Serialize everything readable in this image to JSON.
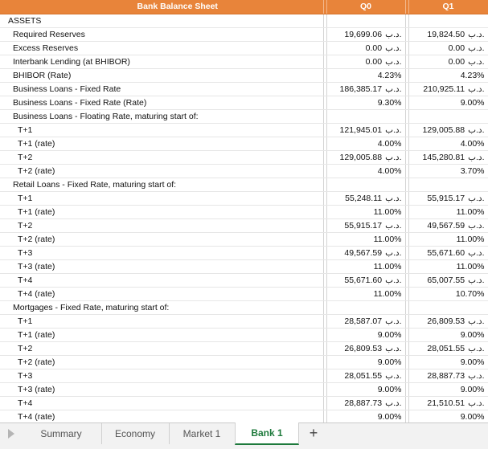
{
  "sheet": {
    "headers": {
      "title": "Bank Balance Sheet",
      "q0": "Q0",
      "q1": "Q1"
    },
    "currency": "د.ب.",
    "rows": [
      {
        "label": "ASSETS",
        "indent": "top",
        "q0": "",
        "q1": "",
        "cur": false
      },
      {
        "label": "Required Reserves",
        "indent": "main",
        "q0": "19,699.06",
        "q1": "19,824.50",
        "cur": true
      },
      {
        "label": "Excess Reserves",
        "indent": "main",
        "q0": "0.00",
        "q1": "0.00",
        "cur": true
      },
      {
        "label": "Interbank Lending (at BHIBOR)",
        "indent": "main",
        "q0": "0.00",
        "q1": "0.00",
        "cur": true
      },
      {
        "label": "BHIBOR (Rate)",
        "indent": "main",
        "q0": "4.23%",
        "q1": "4.23%",
        "cur": false
      },
      {
        "label": "Business Loans - Fixed Rate",
        "indent": "main",
        "q0": "186,385.17",
        "q1": "210,925.11",
        "cur": true
      },
      {
        "label": "Business Loans - Fixed Rate (Rate)",
        "indent": "main",
        "q0": "9.30%",
        "q1": "9.00%",
        "cur": false
      },
      {
        "label": "Business Loans - Floating Rate, maturing start of:",
        "indent": "main",
        "q0": "",
        "q1": "",
        "cur": false
      },
      {
        "label": "T+1",
        "indent": "sub",
        "q0": "121,945.01",
        "q1": "129,005.88",
        "cur": true
      },
      {
        "label": "T+1 (rate)",
        "indent": "sub",
        "q0": "4.00%",
        "q1": "4.00%",
        "cur": false
      },
      {
        "label": "T+2",
        "indent": "sub",
        "q0": "129,005.88",
        "q1": "145,280.81",
        "cur": true
      },
      {
        "label": "T+2 (rate)",
        "indent": "sub",
        "q0": "4.00%",
        "q1": "3.70%",
        "cur": false
      },
      {
        "label": "Retail Loans - Fixed Rate, maturing start of:",
        "indent": "main",
        "q0": "",
        "q1": "",
        "cur": false
      },
      {
        "label": "T+1",
        "indent": "sub",
        "q0": "55,248.11",
        "q1": "55,915.17",
        "cur": true
      },
      {
        "label": "T+1 (rate)",
        "indent": "sub",
        "q0": "11.00%",
        "q1": "11.00%",
        "cur": false
      },
      {
        "label": "T+2",
        "indent": "sub",
        "q0": "55,915.17",
        "q1": "49,567.59",
        "cur": true
      },
      {
        "label": "T+2 (rate)",
        "indent": "sub",
        "q0": "11.00%",
        "q1": "11.00%",
        "cur": false
      },
      {
        "label": "T+3",
        "indent": "sub",
        "q0": "49,567.59",
        "q1": "55,671.60",
        "cur": true
      },
      {
        "label": "T+3 (rate)",
        "indent": "sub",
        "q0": "11.00%",
        "q1": "11.00%",
        "cur": false
      },
      {
        "label": "T+4",
        "indent": "sub",
        "q0": "55,671.60",
        "q1": "65,007.55",
        "cur": true
      },
      {
        "label": "T+4 (rate)",
        "indent": "sub",
        "q0": "11.00%",
        "q1": "10.70%",
        "cur": false
      },
      {
        "label": "Mortgages - Fixed Rate, maturing start of:",
        "indent": "main",
        "q0": "",
        "q1": "",
        "cur": false
      },
      {
        "label": "T+1",
        "indent": "sub",
        "q0": "28,587.07",
        "q1": "26,809.53",
        "cur": true
      },
      {
        "label": "T+1 (rate)",
        "indent": "sub",
        "q0": "9.00%",
        "q1": "9.00%",
        "cur": false
      },
      {
        "label": "T+2",
        "indent": "sub",
        "q0": "26,809.53",
        "q1": "28,051.55",
        "cur": true
      },
      {
        "label": "T+2 (rate)",
        "indent": "sub",
        "q0": "9.00%",
        "q1": "9.00%",
        "cur": false
      },
      {
        "label": "T+3",
        "indent": "sub",
        "q0": "28,051.55",
        "q1": "28,887.73",
        "cur": true
      },
      {
        "label": "T+3 (rate)",
        "indent": "sub",
        "q0": "9.00%",
        "q1": "9.00%",
        "cur": false
      },
      {
        "label": "T+4",
        "indent": "sub",
        "q0": "28,887.73",
        "q1": "21,510.51",
        "cur": true
      },
      {
        "label": "T+4 (rate)",
        "indent": "sub",
        "q0": "9.00%",
        "q1": "9.00%",
        "cur": false
      }
    ]
  },
  "tabs": [
    {
      "label": "Summary",
      "active": false
    },
    {
      "label": "Economy",
      "active": false
    },
    {
      "label": "Market 1",
      "active": false
    },
    {
      "label": "Bank 1",
      "active": true
    }
  ],
  "add_tab_label": "+",
  "colors": {
    "header_bg": "#e8843a",
    "active_tab": "#1e7a3c"
  }
}
